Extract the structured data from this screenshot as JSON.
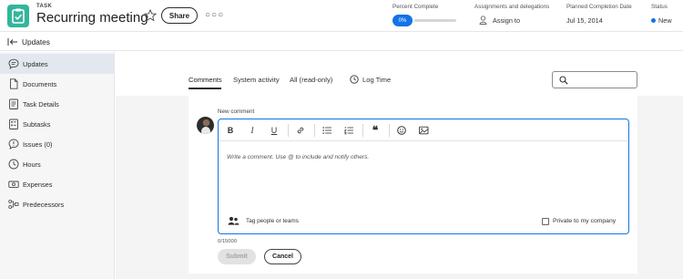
{
  "header": {
    "kicker": "TASK",
    "title": "Recurring meeting",
    "share_label": "Share",
    "more_glyph": "○○○",
    "percent_complete": {
      "label": "Percent Complete",
      "value_text": "0%",
      "progress_fraction": 0
    },
    "assignments": {
      "label": "Assignments and delegations",
      "value": "Assign to"
    },
    "planned_completion": {
      "label": "Planned Completion Date",
      "value": "Jul 15, 2014"
    },
    "status": {
      "label": "Status",
      "value": "New",
      "color": "#1473e6"
    },
    "badge_color": "#33b59c"
  },
  "subheader": {
    "title": "Updates"
  },
  "sidebar": {
    "items": [
      {
        "label": "Updates",
        "icon": "speech-bubble-icon",
        "active": true
      },
      {
        "label": "Documents",
        "icon": "document-icon",
        "active": false
      },
      {
        "label": "Task Details",
        "icon": "task-details-icon",
        "active": false
      },
      {
        "label": "Subtasks",
        "icon": "subtasks-icon",
        "active": false
      },
      {
        "label": "Issues (0)",
        "icon": "issues-icon",
        "active": false
      },
      {
        "label": "Hours",
        "icon": "clock-icon",
        "active": false
      },
      {
        "label": "Expenses",
        "icon": "expenses-icon",
        "active": false
      },
      {
        "label": "Predecessors",
        "icon": "predecessors-icon",
        "active": false
      }
    ]
  },
  "main": {
    "tabs": [
      {
        "label": "Comments",
        "active": true
      },
      {
        "label": "System activity",
        "active": false
      },
      {
        "label": "All (read-only)",
        "active": false
      }
    ],
    "log_time_label": "Log Time",
    "search": {
      "placeholder": ""
    },
    "comment": {
      "new_comment_label": "New comment",
      "toolbar": {
        "bold": "B",
        "italic": "I",
        "underline": "U",
        "link_icon": "link-icon",
        "bullet_list_icon": "bullet-list-icon",
        "numbered_list_icon": "numbered-list-icon",
        "quote_icon": "quote-icon",
        "emoji_icon": "emoji-icon",
        "image_icon": "image-icon"
      },
      "placeholder": "Write a comment. Use @ to include and notify others.",
      "tag_label": "Tag people or teams",
      "private_label": "Private to my company",
      "private_checked": false,
      "char_count": "0/15000",
      "submit_label": "Submit",
      "cancel_label": "Cancel",
      "accent_color": "#1473e6"
    }
  }
}
